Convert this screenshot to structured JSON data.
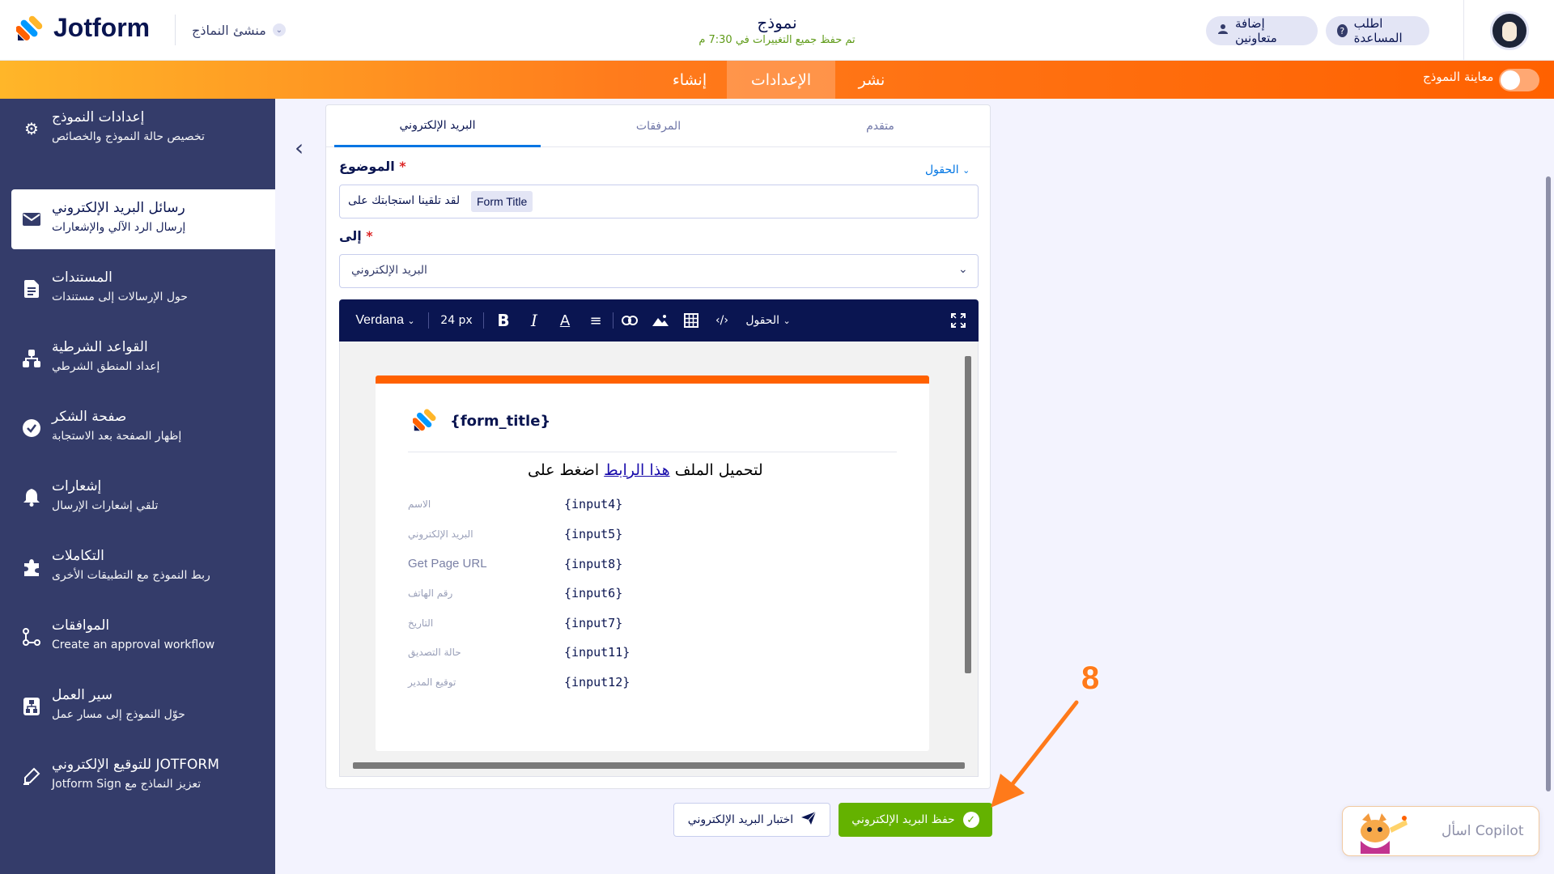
{
  "header": {
    "brand": "Jotform",
    "builder_menu": "منشئ النماذج",
    "form_title": "نموذج",
    "save_status": "تم حفظ جميع التغييرات في 7:30 م",
    "help_button": "اطلب المساعدة",
    "collab_button": "إضافة متعاونين"
  },
  "nav": {
    "publish": "نشر",
    "settings": "الإعدادات",
    "build": "إنشاء",
    "preview_label": "معاينة النموذج"
  },
  "sidebar": {
    "items": [
      {
        "title": "إعدادات النموذج",
        "sub": "تخصيص حالة النموذج والخصائص"
      },
      {
        "title": "رسائل البريد الإلكتروني",
        "sub": "إرسال الرد الآلي والإشعارات"
      },
      {
        "title": "المستندات",
        "sub": "حول الإرسالات إلى مستندات"
      },
      {
        "title": "القواعد الشرطية",
        "sub": "إعداد المنطق الشرطي"
      },
      {
        "title": "صفحة الشكر",
        "sub": "إظهار الصفحة بعد الاستجابة"
      },
      {
        "title": "إشعارات",
        "sub": "تلقي إشعارات الإرسال"
      },
      {
        "title": "التكاملات",
        "sub": "ربط النموذج مع التطبيقات الأخرى"
      },
      {
        "title": "الموافقات",
        "sub": "Create an approval workflow"
      },
      {
        "title": "سير العمل",
        "sub": "حوّل النموذج إلى مسار عمل"
      },
      {
        "title": "JOTFORM للتوقيع الإلكتروني",
        "sub": "تعزيز النماذج مع Jotform Sign"
      }
    ]
  },
  "tabs": {
    "advanced": "متقدم",
    "attachments": "المرفقات",
    "email": "البريد الإلكتروني"
  },
  "form": {
    "subject_label": "الموضوع",
    "fields_link": "الحقول",
    "subject_tag": "Form Title",
    "subject_text": "لقد تلقينا استجابتك على",
    "to_label": "إلى",
    "to_value": "البريد الإلكتروني"
  },
  "toolbar": {
    "font": "Verdana",
    "size": "24 px",
    "fields": "الحقول"
  },
  "email_body": {
    "title_var": "{form_title}",
    "line_prefix": "اضغط على ",
    "line_link": "هذا الرابط",
    "line_suffix": " لتحميل الملف",
    "rows": [
      {
        "label": "الاسم",
        "value": "{input4}"
      },
      {
        "label": "البريد الإلكتروني",
        "value": "{input5}"
      },
      {
        "label": "Get Page URL",
        "value": "{input8}"
      },
      {
        "label": "رقم الهاتف",
        "value": "{input6}"
      },
      {
        "label": "التاريخ",
        "value": "{input7}"
      },
      {
        "label": "حالة التصديق",
        "value": "{input11}"
      },
      {
        "label": "توقيع المدير",
        "value": "{input12}"
      }
    ]
  },
  "actions": {
    "save": "حفظ البريد الإلكتروني",
    "test": "اختبار البريد الإلكتروني"
  },
  "copilot": {
    "label": "اسأل Copilot"
  },
  "annotation": {
    "step": "8"
  },
  "colors": {
    "accent_orange": "#ff6100",
    "sidebar_bg": "#343c6a",
    "save_green": "#64b200",
    "toolbar_navy": "#0a1551",
    "link_blue": "#0075e3"
  }
}
